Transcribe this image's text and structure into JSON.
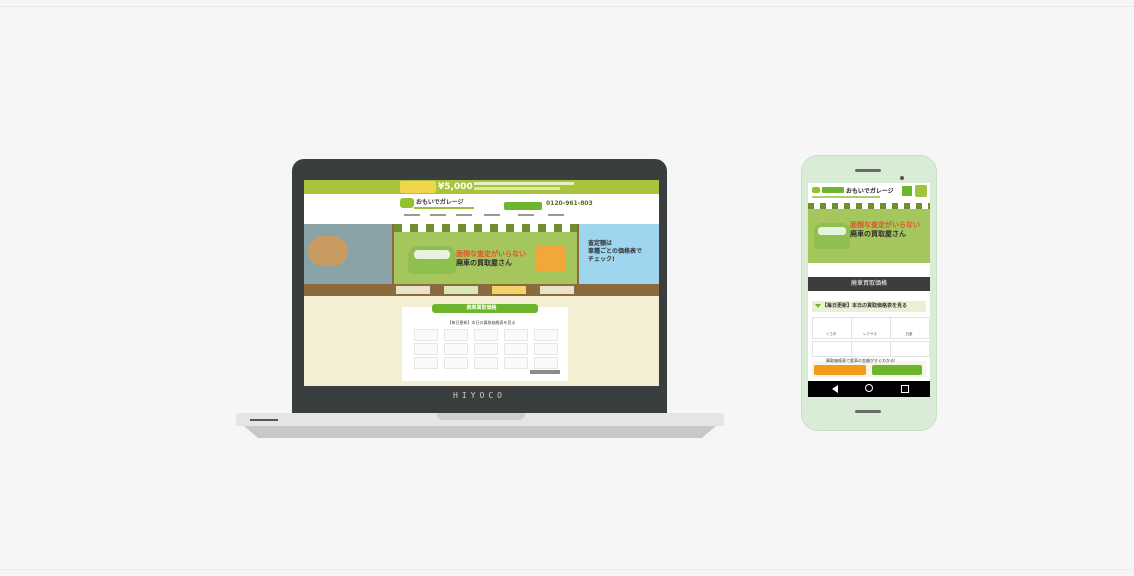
{
  "laptop": {
    "brand": "HIYOCO",
    "site": {
      "price": "¥5,000",
      "logo_text": "おもいでガレージ",
      "phone": "0120-961-803",
      "hero_text_line1": "面倒な査定がいらない",
      "hero_text_line2": "廃車の買取屋さん",
      "hero_right_line1": "査定額は",
      "hero_right_line2": "車種ごとの価格表で",
      "hero_right_line3": "チェック!",
      "panel_title": "廃車買取価格",
      "panel_subtitle": "【毎日更新】本日の買取価格表を見る"
    }
  },
  "phone": {
    "logo_text": "おもいでガレージ",
    "hero_text_line1": "面倒な査定がいらない",
    "hero_text_line2": "廃車の買取屋さん",
    "section_title": "廃車買取価格",
    "daily_bar": "【毎日更新】本日の買取価格表を見る",
    "brands": [
      "トヨタ",
      "レクサス",
      "日産"
    ],
    "cta_text": "買取価格表で愛車の金額がすぐわかる!",
    "nav_icons": [
      "back-icon",
      "home-icon",
      "recents-icon"
    ]
  },
  "colors": {
    "accent_green": "#6cb52d",
    "header_green": "#a7c43b",
    "highlight_orange": "#e0542b"
  }
}
